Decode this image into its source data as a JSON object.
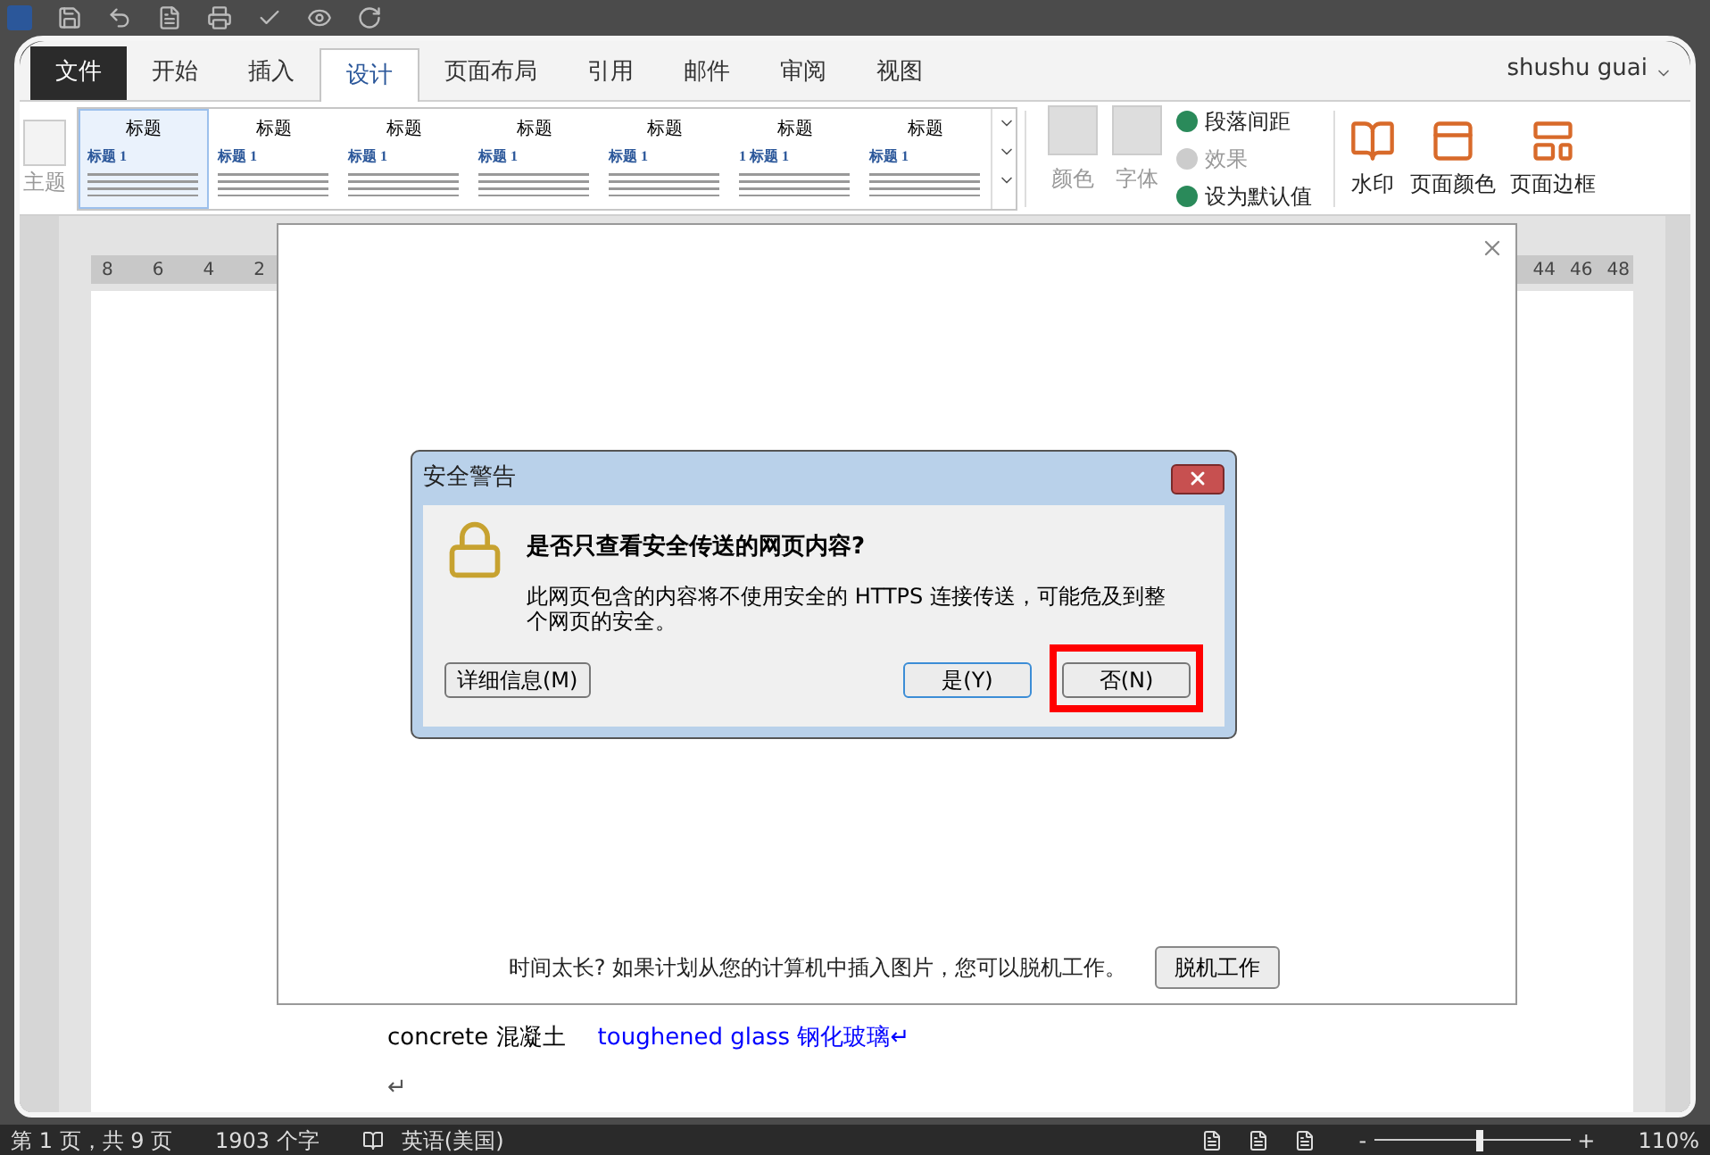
{
  "ribbon_tabs": [
    {
      "label": "文件",
      "kind": "file",
      "selected": false
    },
    {
      "label": "开始",
      "kind": "tab",
      "selected": false
    },
    {
      "label": "插入",
      "kind": "tab",
      "selected": false
    },
    {
      "label": "设计",
      "kind": "tab",
      "selected": true
    },
    {
      "label": "页面布局",
      "kind": "tab",
      "selected": false
    },
    {
      "label": "引用",
      "kind": "tab",
      "selected": false
    },
    {
      "label": "邮件",
      "kind": "tab",
      "selected": false
    },
    {
      "label": "审阅",
      "kind": "tab",
      "selected": false
    },
    {
      "label": "视图",
      "kind": "tab",
      "selected": false
    }
  ],
  "user": "shushu guai",
  "theme_button": "主题",
  "style_gallery": [
    {
      "title": "标题",
      "heading": "标题 1",
      "selected": true
    },
    {
      "title": "标题",
      "heading": "标题 1",
      "selected": false
    },
    {
      "title": "标题",
      "heading": "标题 1",
      "selected": false
    },
    {
      "title": "标题",
      "heading": "标题 1",
      "selected": false
    },
    {
      "title": "标题",
      "heading": "标题 1",
      "selected": false
    },
    {
      "title": "标题",
      "heading": "1 标题 1",
      "selected": false
    },
    {
      "title": "标题",
      "heading": "标题 1",
      "selected": false
    }
  ],
  "design_commands": [
    {
      "label": "颜色",
      "kind": "large",
      "disabled": true
    },
    {
      "label": "字体",
      "kind": "large",
      "disabled": true
    },
    {
      "label": "段落间距",
      "kind": "small",
      "disabled": false
    },
    {
      "label": "效果",
      "kind": "small",
      "disabled": true
    },
    {
      "label": "设为默认值",
      "kind": "small",
      "disabled": false
    }
  ],
  "page_background": [
    "水印",
    "页面颜色",
    "页面边框"
  ],
  "ruler": {
    "left_ticks": [
      "8",
      "6",
      "4",
      "2"
    ],
    "right_ticks": [
      "44",
      "46",
      "48"
    ]
  },
  "document": {
    "lines": [
      [
        {
          "text": "concrete  混凝土",
          "color": "#000000"
        },
        {
          "text": "toughened glass  钢化玻璃↵",
          "color": "#0000ff"
        }
      ],
      [
        {
          "text": "↵",
          "color": "#555555"
        }
      ]
    ]
  },
  "overlay": {
    "hint": "时间太长? 如果计划从您的计算机中插入图片，您可以脱机工作。",
    "button": "脱机工作"
  },
  "dialog": {
    "title": "安全警告",
    "question": "是否只查看安全传送的网页内容?",
    "message": "此网页包含的内容将不使用安全的 HTTPS 连接传送，可能危及到整个网页的安全。",
    "buttons": [
      {
        "label": "详细信息(M)",
        "focused": false,
        "highlighted": false
      },
      {
        "label": "是(Y)",
        "focused": true,
        "highlighted": false
      },
      {
        "label": "否(N)",
        "focused": false,
        "highlighted": true
      }
    ]
  },
  "status_bar": {
    "page": "第 1 页，共 9 页",
    "words": "1903 个字",
    "language": "英语(美国)",
    "zoom_minus": "-",
    "zoom_plus": "+",
    "zoom_slider": {
      "level": 0.54
    },
    "zoom": "110%"
  }
}
